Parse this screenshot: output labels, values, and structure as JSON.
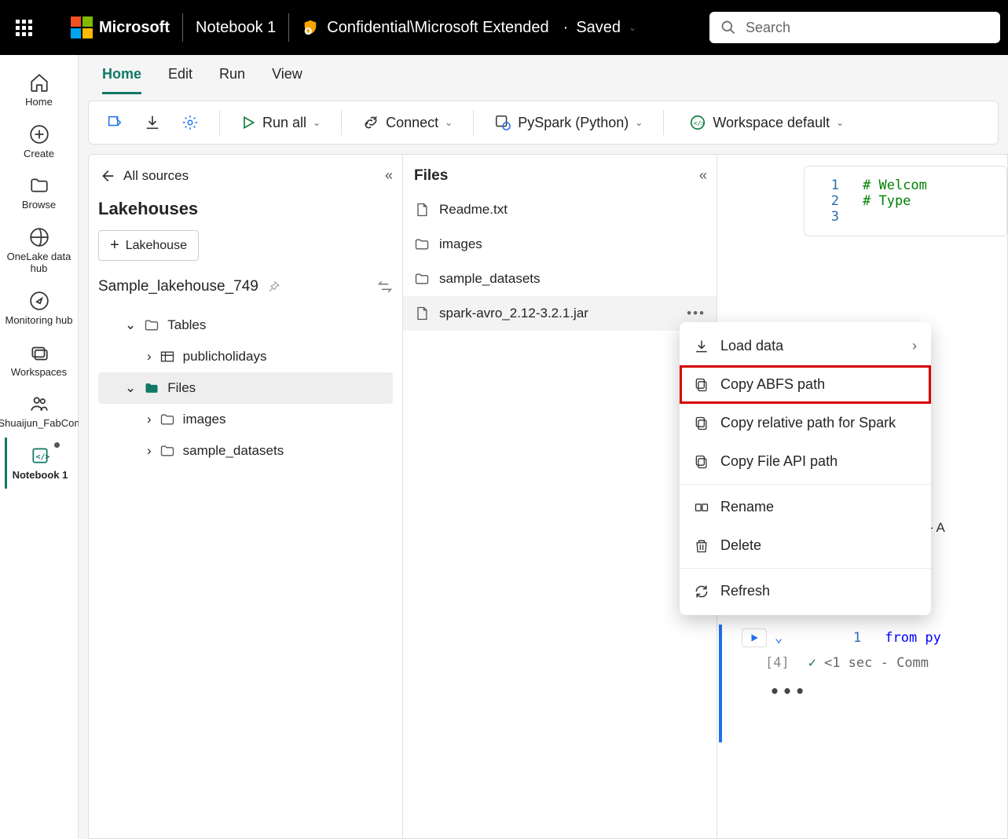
{
  "topbar": {
    "brand": "Microsoft",
    "notebook_name": "Notebook 1",
    "confidentiality": "Confidential\\Microsoft Extended",
    "saved_label": "Saved",
    "search_placeholder": "Search"
  },
  "rail": {
    "home": "Home",
    "create": "Create",
    "browse": "Browse",
    "onelake": "OneLake data hub",
    "monitoring": "Monitoring hub",
    "workspaces": "Workspaces",
    "user_ws": "Shuaijun_FabCon",
    "notebook": "Notebook 1"
  },
  "ribbon": {
    "home": "Home",
    "edit": "Edit",
    "run": "Run",
    "view": "View"
  },
  "toolbar": {
    "run_all": "Run all",
    "connect": "Connect",
    "language": "PySpark (Python)",
    "env": "Workspace default"
  },
  "left_panel": {
    "back": "All sources",
    "title": "Lakehouses",
    "add_label": "Lakehouse",
    "lakehouse_name": "Sample_lakehouse_749",
    "tree": {
      "tables": "Tables",
      "publicholidays": "publicholidays",
      "files": "Files",
      "images": "images",
      "sample_datasets": "sample_datasets"
    }
  },
  "files_panel": {
    "title": "Files",
    "items": [
      {
        "name": "Readme.txt",
        "type": "file"
      },
      {
        "name": "images",
        "type": "folder"
      },
      {
        "name": "sample_datasets",
        "type": "folder"
      },
      {
        "name": "spark-avro_2.12-3.2.1.jar",
        "type": "file"
      }
    ]
  },
  "context_menu": {
    "load_data": "Load data",
    "copy_abfs": "Copy ABFS path",
    "copy_relative": "Copy relative path for Spark",
    "copy_fileapi": "Copy File API path",
    "rename": "Rename",
    "delete": "Delete",
    "refresh": "Refresh"
  },
  "editor": {
    "line1_comment": "# Welcom",
    "line2_comment": "# Type",
    "lower_code": "from py",
    "status": "<1 sec - Comm",
    "cell_label": "[4]",
    "annotation": " - A"
  }
}
